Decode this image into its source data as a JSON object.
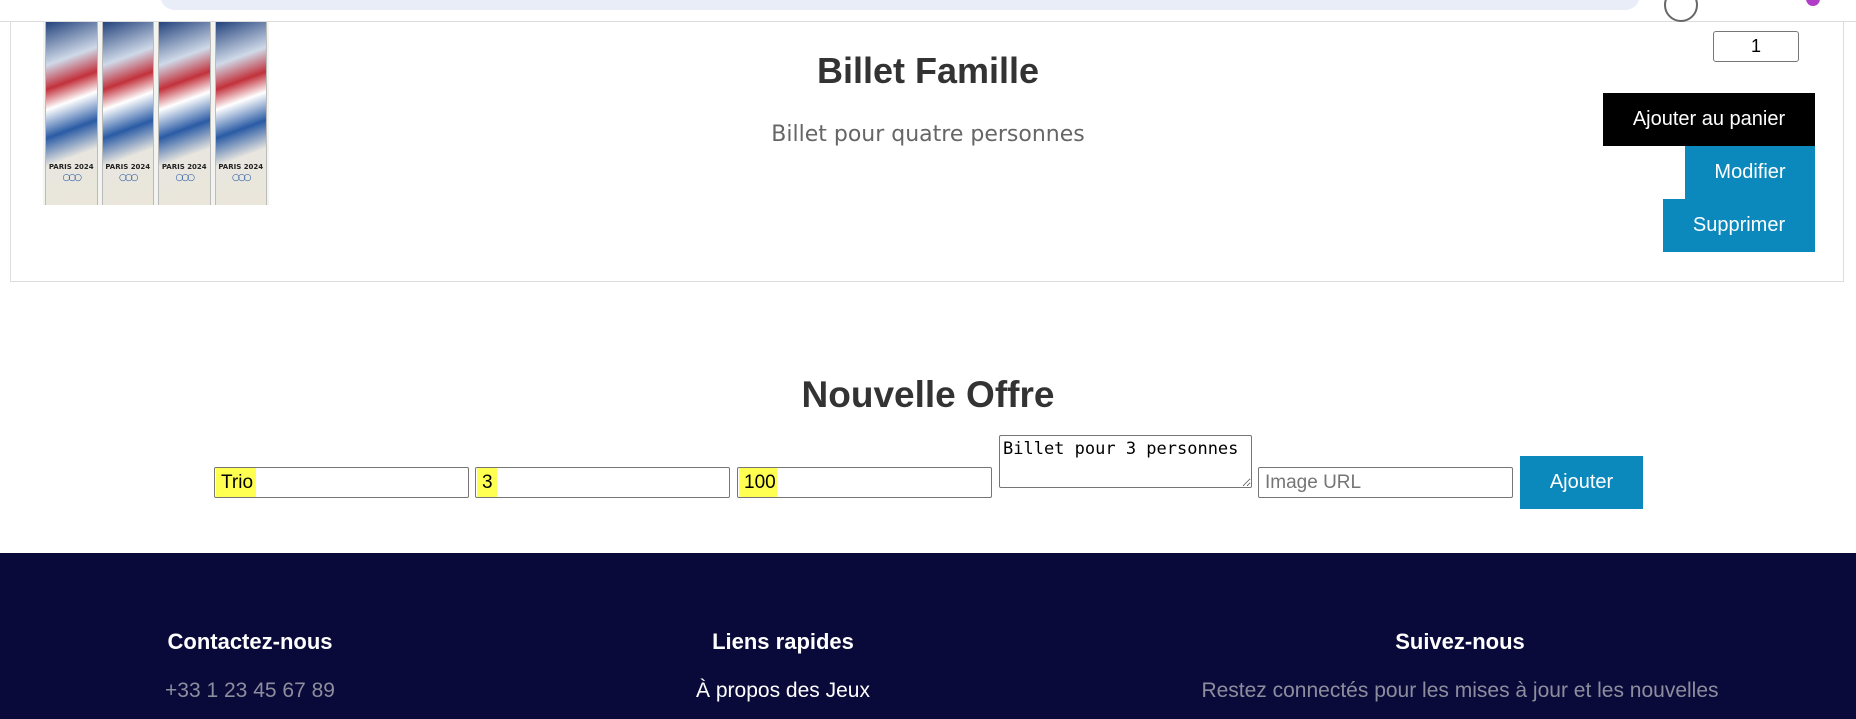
{
  "card": {
    "title": "Billet Famille",
    "description": "Billet pour quatre personnes",
    "quantity": "1",
    "ticket_labels": [
      "PARIS 2024",
      "PARIS 2024",
      "PARIS 2024",
      "PARIS 2024"
    ],
    "buttons": {
      "add_to_cart": "Ajouter au panier",
      "edit": "Modifier",
      "delete": "Supprimer"
    }
  },
  "new_offer": {
    "title": "Nouvelle Offre",
    "name_value": "Trio",
    "quantity_value": "3",
    "price_value": "100",
    "description_value": "Billet pour 3 personnes",
    "image_placeholder": "Image URL",
    "submit_label": "Ajouter"
  },
  "footer": {
    "contact": {
      "heading": "Contactez-nous",
      "phone": "+33 1 23 45 67 89"
    },
    "links": {
      "heading": "Liens rapides",
      "item": "À propos des Jeux"
    },
    "social": {
      "heading": "Suivez-nous",
      "text": "Restez connectés pour les mises à jour et les nouvelles"
    }
  },
  "colors": {
    "primary_button": "#0b89bd",
    "cart_button": "#000000",
    "footer_bg": "#0a0a3a",
    "highlight": "#ffff33"
  }
}
